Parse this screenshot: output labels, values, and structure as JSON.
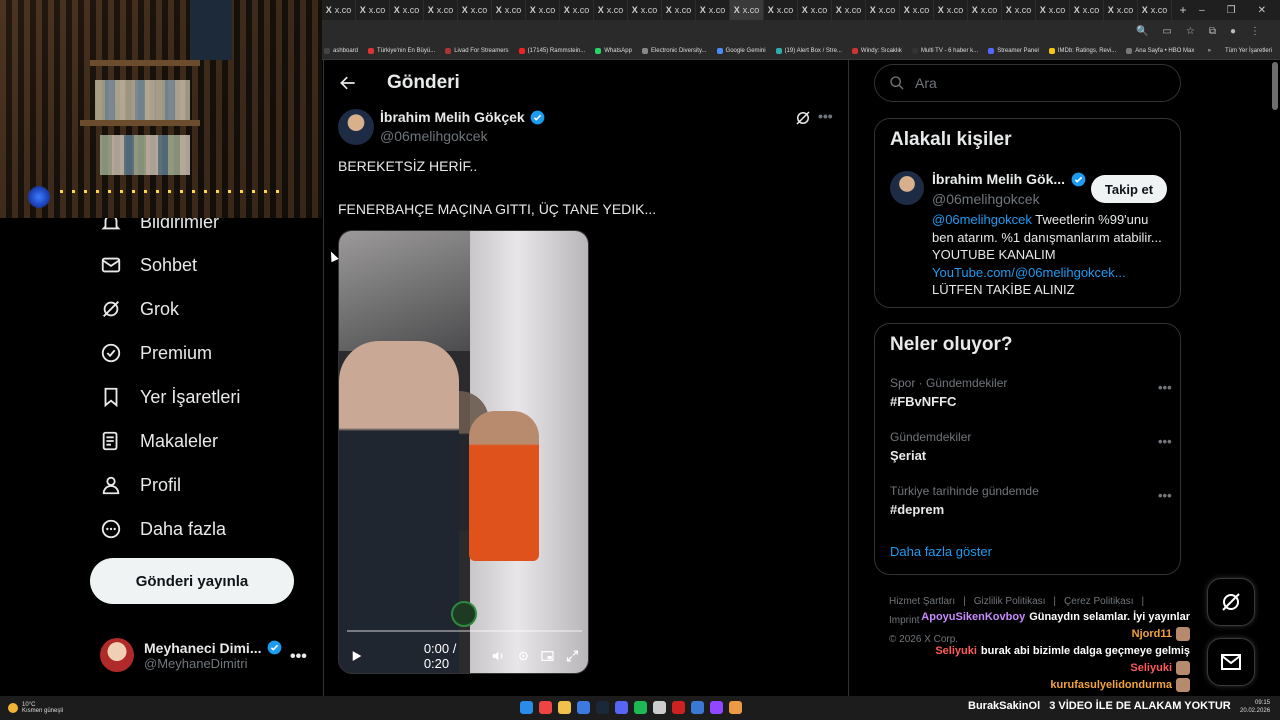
{
  "browser": {
    "tab_label": "x.co",
    "tab_label_alt": "X",
    "bookmarks": [
      {
        "label": "ashboard",
        "color": "#444"
      },
      {
        "label": "Türkiye'nin En Büyü...",
        "color": "#d33"
      },
      {
        "label": "Livad For Streamers",
        "color": "#a33"
      },
      {
        "label": "(17145) Rammstein...",
        "color": "#e22"
      },
      {
        "label": "WhatsApp",
        "color": "#25d366"
      },
      {
        "label": "Electronic Diversity...",
        "color": "#888"
      },
      {
        "label": "Google Gemini",
        "color": "#4a8cf7"
      },
      {
        "label": "(19) Alert Box / Stre...",
        "color": "#3aa"
      },
      {
        "label": "Windy: Sıcaklık",
        "color": "#c33"
      },
      {
        "label": "Multi TV - 6 haber k...",
        "color": "#333"
      },
      {
        "label": "Streamer Panel",
        "color": "#56f"
      },
      {
        "label": "IMDb: Ratings, Revi...",
        "color": "#f5c518"
      },
      {
        "label": "Ana Sayfa • HBO Max",
        "color": "#777"
      }
    ],
    "bookmarks_more": "»",
    "bookmarks_all": "Tüm Yer İşaretleri"
  },
  "sidebar": {
    "items": [
      {
        "label": "Bildirimler",
        "icon": "bell-icon"
      },
      {
        "label": "Sohbet",
        "icon": "mail-icon"
      },
      {
        "label": "Grok",
        "icon": "grok-icon"
      },
      {
        "label": "Premium",
        "icon": "premium-icon"
      },
      {
        "label": "Yer İşaretleri",
        "icon": "bookmark-icon"
      },
      {
        "label": "Makaleler",
        "icon": "article-icon"
      },
      {
        "label": "Profil",
        "icon": "profile-icon"
      },
      {
        "label": "Daha fazla",
        "icon": "more-circle-icon"
      }
    ],
    "post_button": "Gönderi yayınla",
    "account": {
      "name": "Meyhaneci Dimi...",
      "handle": "@MeyhaneDimitri",
      "more": "•••"
    }
  },
  "main": {
    "title": "Gönderi",
    "tweet": {
      "name": "İbrahim Melih Gökçek",
      "handle": "@06melihgokcek",
      "line1": "BEREKETSİZ HERİF..",
      "line2": "FENERBAHÇE MAÇINA GITTI, ÜÇ TANE YEDIK...",
      "more": "•••",
      "video": {
        "time": "0:00 / 0:20",
        "progress": 0.0
      }
    }
  },
  "right": {
    "search_placeholder": "Ara",
    "relevant": {
      "title": "Alakalı kişiler",
      "name": "İbrahim Melih Gök...",
      "handle": "@06melihgokcek",
      "follow": "Takip et",
      "bio_handle": "@06melihgokcek",
      "bio_text1": " Tweetlerin %99'unu ben atarım. %1 danışmanlarım atabilir...",
      "bio_text2": "YOUTUBE KANALIM",
      "bio_link": "YouTube.com/@06melihgokcek...",
      "bio_text3": "LÜTFEN TAKİBE ALINIZ"
    },
    "trends": {
      "title": "Neler oluyor?",
      "items": [
        {
          "meta": "Spor · Gündemdekiler",
          "name": "#FBvNFFC"
        },
        {
          "meta": "Gündemdekiler",
          "name": "Şeriat"
        },
        {
          "meta": "Türkiye tarihinde gündemde",
          "name": "#deprem"
        }
      ],
      "more": "•••",
      "show_more": "Daha fazla göster"
    },
    "footer": {
      "links": [
        "Hizmet Şartları",
        "Gizlilik Politikası",
        "Çerez Politikası",
        "Imprint"
      ],
      "sep": "|",
      "copyright": "© 2026 X Corp."
    }
  },
  "chat": [
    {
      "user": "ApoyuSikenKovboy",
      "msg": "Günaydın selamlar. İyi yayınlar",
      "color": "#c78bff"
    },
    {
      "user": "Njord11",
      "msg": "",
      "color": "#f2a33a"
    },
    {
      "user": "Seliyuki",
      "msg": "burak abi bizimle dalga geçmeye gelmiş",
      "color": "#ff5a5a"
    },
    {
      "user": "Seliyuki",
      "msg": "",
      "color": "#ff5a5a"
    },
    {
      "user": "kurufasulyelidondurma",
      "msg": "",
      "color": "#f2a33a"
    }
  ],
  "taskbar": {
    "weather_temp": "10°C",
    "weather_text": "Kısmen güneşli",
    "ticker_user": "BurakSakinOl",
    "ticker_text": "3 VİDEO İLE DE ALAKAM YOKTUR",
    "time": "09:15",
    "date": "20.02.2026"
  }
}
